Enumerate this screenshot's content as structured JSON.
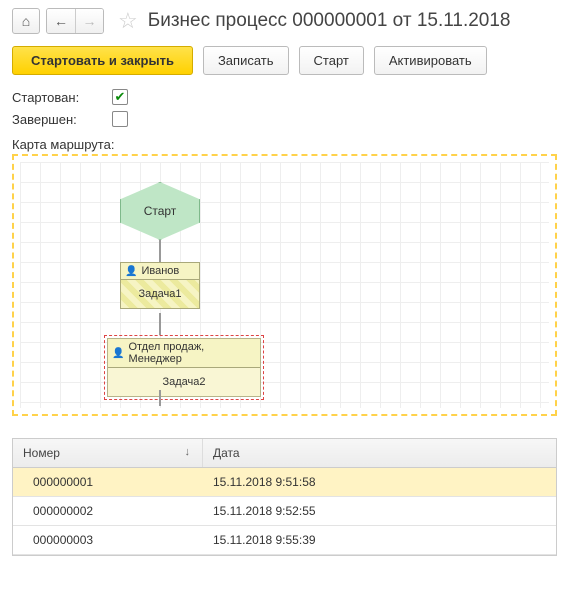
{
  "header": {
    "title": "Бизнес процесс 000000001 от 15.11.2018"
  },
  "toolbar": {
    "start_and_close": "Стартовать и закрыть",
    "write": "Записать",
    "start": "Старт",
    "activate": "Активировать"
  },
  "status": {
    "started_label": "Стартован:",
    "started_checked": true,
    "finished_label": "Завершен:",
    "finished_checked": false
  },
  "route": {
    "label": "Карта маршрута:",
    "start_node": "Старт",
    "task1": {
      "assignee": "Иванов",
      "name": "Задача1"
    },
    "task2": {
      "assignee": "Отдел продаж, Менеджер",
      "name": "Задача2"
    }
  },
  "table": {
    "columns": {
      "number": "Номер",
      "date": "Дата"
    },
    "rows": [
      {
        "number": "000000001",
        "date": "15.11.2018 9:51:58",
        "selected": true
      },
      {
        "number": "000000002",
        "date": "15.11.2018 9:52:55",
        "selected": false
      },
      {
        "number": "000000003",
        "date": "15.11.2018 9:55:39",
        "selected": false
      }
    ]
  },
  "icons": {
    "home": "⌂",
    "back": "←",
    "forward": "→",
    "star": "☆",
    "check": "✔",
    "sort_down": "↓",
    "user": "👤"
  }
}
